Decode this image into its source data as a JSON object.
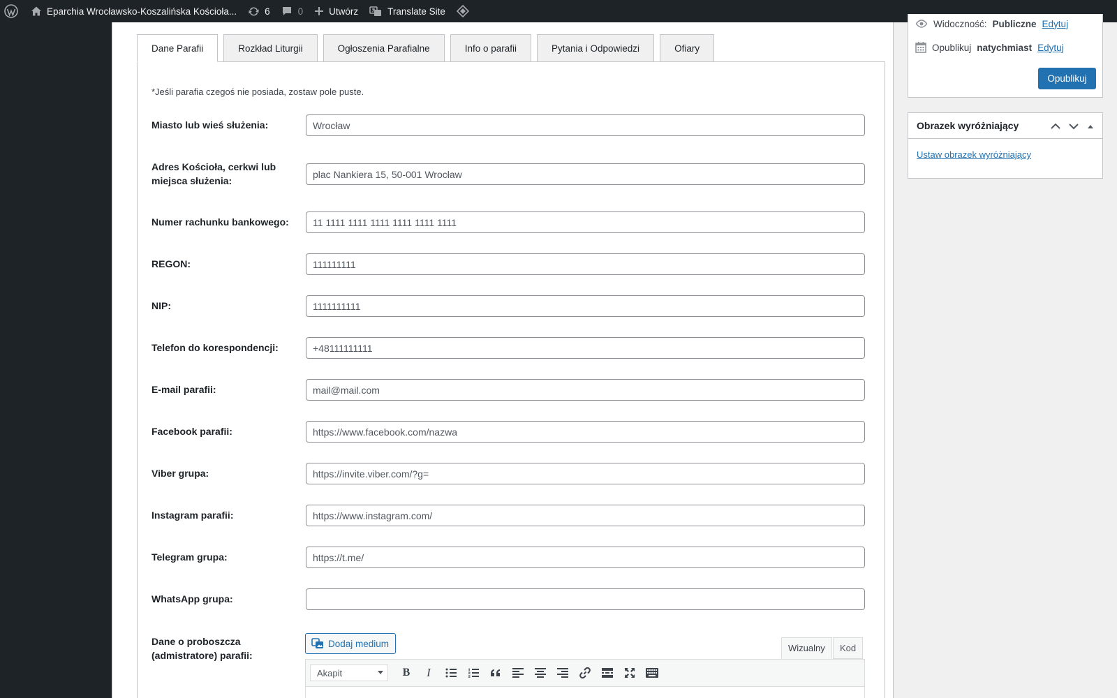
{
  "admin_bar": {
    "site_name": "Eparchia Wrocławsko-Koszalińska Kościoła...",
    "updates_count": "6",
    "comments_count": "0",
    "new_label": "Utwórz",
    "translate_label": "Translate Site"
  },
  "tabs": [
    {
      "label": "Dane Parafii",
      "active": true
    },
    {
      "label": "Rozkład Liturgii"
    },
    {
      "label": "Ogłoszenia Parafialne"
    },
    {
      "label": "Info o parafii"
    },
    {
      "label": "Pytania i Odpowiedzi"
    },
    {
      "label": "Ofiary"
    }
  ],
  "form": {
    "note": "*Jeśli parafia czegoś nie posiada, zostaw pole puste.",
    "fields": [
      {
        "label": "Miasto lub wieś służenia:",
        "value": "Wrocław"
      },
      {
        "label": "Adres Kościoła, cerkwi lub miejsca służenia:",
        "value": "plac Nankiera 15, 50-001 Wrocław"
      },
      {
        "label": "Numer rachunku bankowego:",
        "value": "11 1111 1111 1111 1111 1111 1111"
      },
      {
        "label": "REGON:",
        "value": "111111111"
      },
      {
        "label": "NIP:",
        "value": "1111111111"
      },
      {
        "label": "Telefon do korespondencji:",
        "value": "+48111111111"
      },
      {
        "label": "E-mail parafii:",
        "value": "mail@mail.com"
      },
      {
        "label": "Facebook parafii:",
        "value": "https://www.facebook.com/nazwa"
      },
      {
        "label": "Viber grupa:",
        "value": "https://invite.viber.com/?g="
      },
      {
        "label": "Instagram parafii:",
        "value": "https://www.instagram.com/"
      },
      {
        "label": "Telegram grupa:",
        "value": "https://t.me/"
      },
      {
        "label": "WhatsApp grupa:",
        "value": ""
      }
    ],
    "editor_field_label": "Dane o proboszcza (admistratore) parafii:",
    "add_media_label": "Dodaj medium",
    "visual_tab": "Wizualny",
    "code_tab": "Kod",
    "format_select": "Akapit",
    "toolbar_icons": [
      "bold-icon",
      "italic-icon",
      "bullet-list-icon",
      "numbered-list-icon",
      "blockquote-icon",
      "align-left-icon",
      "align-center-icon",
      "align-right-icon",
      "link-icon",
      "read-more-icon",
      "fullscreen-icon",
      "toolbar-toggle-icon"
    ]
  },
  "publish": {
    "visibility_label": "Widoczność:",
    "visibility_value": "Publiczne",
    "edit_label": "Edytuj",
    "publish_label": "Opublikuj",
    "publish_when": "natychmiast",
    "publish_button": "Opublikuj"
  },
  "featured_image": {
    "title": "Obrazek wyróżniający",
    "set_link": "Ustaw obrazek wyróżniający"
  },
  "colors": {
    "admin_bar_bg": "#1d2327",
    "primary": "#2271b1",
    "page_bg": "#f0f0f1"
  }
}
